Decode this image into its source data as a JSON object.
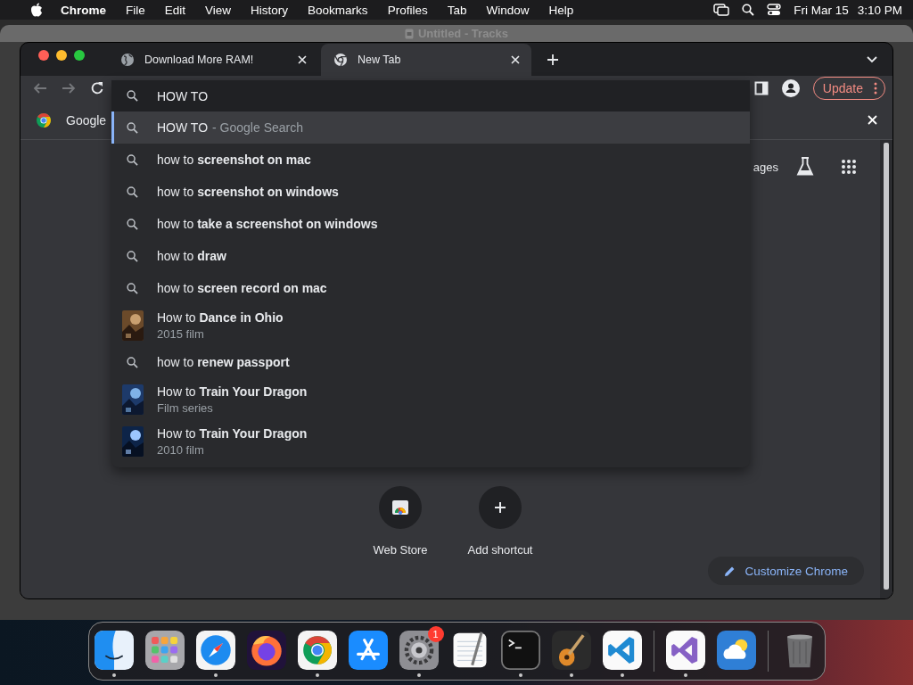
{
  "menubar": {
    "app": "Chrome",
    "menus": [
      "File",
      "Edit",
      "View",
      "History",
      "Bookmarks",
      "Profiles",
      "Tab",
      "Window",
      "Help"
    ],
    "date": "Fri Mar 15",
    "time": "3:10 PM"
  },
  "background_window": {
    "title": "Untitled - Tracks"
  },
  "browser": {
    "tabs": [
      {
        "title": "Download More RAM!",
        "kind": "globe",
        "selected": false
      },
      {
        "title": "New Tab",
        "kind": "chrome",
        "selected": true
      }
    ],
    "nav": [
      {
        "kind": "back",
        "disabled": true
      },
      {
        "kind": "forward",
        "disabled": true
      },
      {
        "kind": "reload",
        "disabled": false
      }
    ],
    "omnibox": {
      "value": "HOW TO"
    },
    "update_button": "Update",
    "suggestions": [
      {
        "kind": "search",
        "text": "HOW TO",
        "detail": "- Google Search",
        "selected": true
      },
      {
        "kind": "search",
        "text": "how to **screenshot on mac**",
        "selected": false
      },
      {
        "kind": "search",
        "text": "how to **screenshot on windows**",
        "selected": false
      },
      {
        "kind": "search",
        "text": "how to **take a screenshot on windows**",
        "selected": false
      },
      {
        "kind": "search",
        "text": "how to **draw**",
        "selected": false
      },
      {
        "kind": "search",
        "text": "how to **screen record on mac**",
        "selected": false
      },
      {
        "kind": "entity",
        "text": "How to **Dance in Ohio**",
        "detail": "2015 film",
        "selected": false
      },
      {
        "kind": "search",
        "text": "how to **renew passport**",
        "selected": false
      },
      {
        "kind": "entity",
        "text": "How to **Train Your Dragon**",
        "detail": "Film series",
        "selected": false
      },
      {
        "kind": "entity",
        "text": "How to **Train Your Dragon**",
        "detail": "2010 film",
        "selected": false
      }
    ],
    "infobar": {
      "text": "Google"
    },
    "header_link": "ages",
    "shortcuts": [
      {
        "label": "Web Store",
        "kind": "store"
      },
      {
        "label": "Add shortcut",
        "kind": "add"
      }
    ],
    "customize_button": "Customize Chrome"
  },
  "dock": [
    {
      "items": [
        {
          "kind": "finder",
          "running": true
        },
        {
          "kind": "launchpad",
          "running": false
        },
        {
          "kind": "safari",
          "running": true
        },
        {
          "kind": "firefox",
          "running": false
        },
        {
          "kind": "chrome",
          "running": true
        },
        {
          "kind": "appstore",
          "running": false
        },
        {
          "kind": "settings",
          "running": true,
          "badge": "1"
        },
        {
          "kind": "textedit",
          "running": false
        },
        {
          "kind": "terminal",
          "running": true
        },
        {
          "kind": "garageband",
          "running": true
        },
        {
          "kind": "vscode",
          "running": true
        }
      ]
    },
    {
      "items": [
        {
          "kind": "visualstudio",
          "running": true
        },
        {
          "kind": "weather",
          "running": false
        }
      ]
    },
    {
      "items": [
        {
          "kind": "trash",
          "running": false
        }
      ]
    }
  ]
}
